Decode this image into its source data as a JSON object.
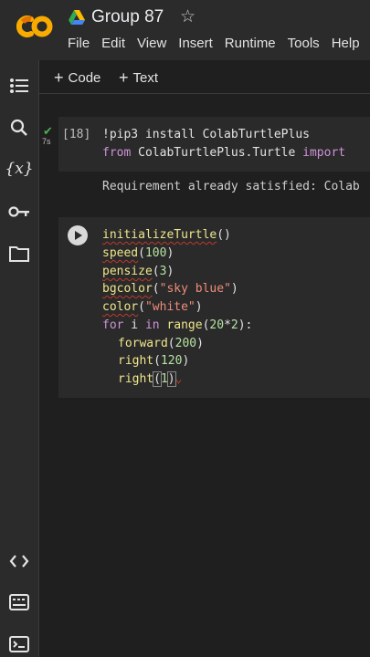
{
  "app": {
    "title": "Group 87",
    "menu": [
      "File",
      "Edit",
      "View",
      "Insert",
      "Runtime",
      "Tools",
      "Help"
    ]
  },
  "toolbar": {
    "code_label": "Code",
    "text_label": "Text"
  },
  "sidebar": {
    "top_icons": [
      "table-of-contents-icon",
      "search-icon",
      "variables-icon",
      "secrets-key-icon",
      "files-folder-icon"
    ],
    "bottom_icons": [
      "code-snippets-icon",
      "command-palette-icon",
      "terminal-icon"
    ]
  },
  "cell1": {
    "exec_count": "[18]",
    "exec_time": "7s",
    "line1": "!pip3 install ColabTurtlePlus",
    "line2_kw1": "from",
    "line2_mod": " ColabTurtlePlus.Turtle ",
    "line2_kw2": "import",
    "output": "Requirement already satisfied: Colab"
  },
  "cell2": {
    "lines": {
      "l1_fn": "initializeTurtle",
      "l1_rest": "()",
      "l2_fn": "speed",
      "l2_num": "100",
      "l3_fn": "pensize",
      "l3_num": "3",
      "l4_fn": "bgcolor",
      "l4_str": "\"sky blue\"",
      "l5_fn": "color",
      "l5_str": "\"white\"",
      "l6_for": "for",
      "l6_var": " i ",
      "l6_in": "in",
      "l6_range": " range",
      "l6_num1": "20",
      "l6_num2": "2",
      "l7_fn": "forward",
      "l7_num": "200",
      "l8_fn": "right",
      "l8_num": "120",
      "l9_fn": "right",
      "l9_num": "1"
    }
  },
  "colors": {
    "accent_orange": "#f9ab00",
    "success_green": "#4caf50"
  }
}
